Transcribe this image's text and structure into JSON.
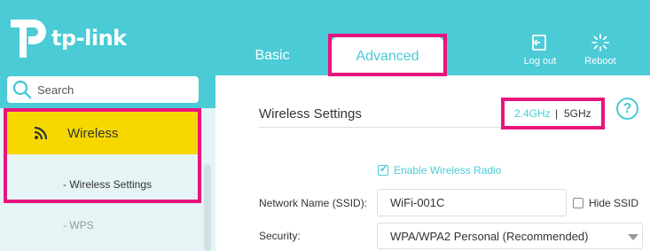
{
  "brand": {
    "name": "tp-link",
    "color": "#4acbd6",
    "highlight": "#e8147d",
    "active_nav": "#f6d800"
  },
  "tabs": [
    {
      "label": "Basic"
    },
    {
      "label": "Advanced"
    }
  ],
  "header_actions": {
    "logout": {
      "label": "Log out",
      "icon": "logout-icon"
    },
    "reboot": {
      "label": "Reboot",
      "icon": "reboot-icon"
    }
  },
  "sidebar": {
    "search_placeholder": "Search",
    "active_item": {
      "label": "Wireless",
      "icon": "wifi-icon"
    },
    "sub_items": [
      {
        "label": "- Wireless Settings"
      },
      {
        "label": "- WPS"
      }
    ]
  },
  "main": {
    "section_title": "Wireless Settings",
    "bands": {
      "band1": "2.4GHz",
      "separator": "|",
      "band2": "5GHz",
      "active": "2.4GHz"
    },
    "help_icon": "question-icon",
    "enable_wireless_label": "Enable Wireless Radio",
    "enable_wireless_checked": true,
    "ssid_label": "Network Name (SSID):",
    "ssid_value": "WiFi-001C",
    "hide_ssid_label": "Hide SSID",
    "hide_ssid_checked": false,
    "security_label": "Security:",
    "security_value": "WPA/WPA2 Personal (Recommended)"
  }
}
